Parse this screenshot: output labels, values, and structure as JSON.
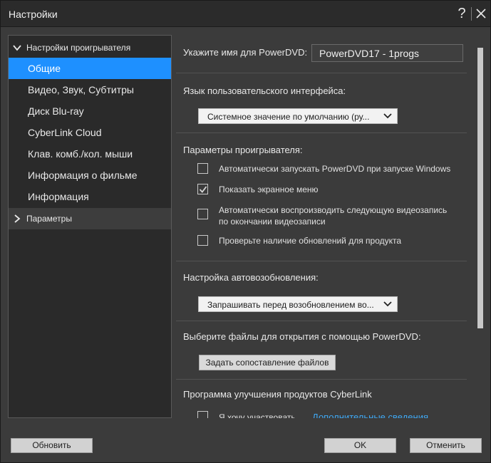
{
  "window": {
    "title": "Настройки"
  },
  "titlebar": {
    "help": "?"
  },
  "sidebar": {
    "group1": "Настройки проигрывателя",
    "items": [
      "Общие",
      "Видео, Звук, Субтитры",
      "Диск Blu-ray",
      "CyberLink Cloud",
      "Клав. комб./кол. мыши",
      "Информация о фильме",
      "Информация"
    ],
    "group2": "Параметры"
  },
  "general": {
    "name_label": "Укажите имя для PowerDVD:",
    "name_value": "PowerDVD17 - 1progs",
    "ui_lang_label": "Язык пользовательского интерфейса:",
    "ui_lang_value": "Системное значение по умолчанию (ру...",
    "player_params_label": "Параметры проигрывателя:",
    "checkboxes": [
      {
        "label": "Автоматически запускать PowerDVD при запуске Windows",
        "checked": false
      },
      {
        "label": "Показать экранное меню",
        "checked": true
      },
      {
        "label_line1": "Автоматически воспроизводить следующую видеозапись",
        "label_line2": "по окончании видеозаписи",
        "checked": false
      },
      {
        "label": "Проверьте наличие обновлений для продукта",
        "checked": false
      }
    ],
    "resume_label": "Настройка автовозобновления:",
    "resume_value": "Запрашивать перед возобновлением во...",
    "file_assoc_label": "Выберите файлы для открытия с помощью PowerDVD:",
    "file_assoc_button": "Задать сопоставление файлов",
    "improvement_label": "Программа улучшения продуктов CyberLink",
    "participate_label": "Я хочу участвовать",
    "more_info_link": "Дополнительные сведения"
  },
  "footer": {
    "update": "Обновить",
    "ok": "OK",
    "cancel": "Отменить"
  },
  "colors": {
    "accent": "#1e90ff",
    "link": "#3fa9f5",
    "window_bg": "#3b3b3b",
    "sidebar_bg": "#2a2a2a"
  }
}
